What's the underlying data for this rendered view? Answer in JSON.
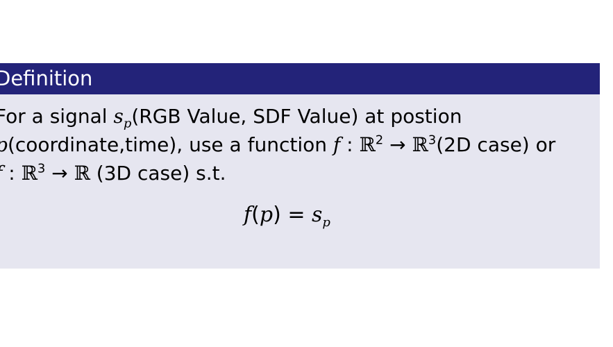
{
  "block": {
    "title": "Definition",
    "colors": {
      "title_bg": "#232379",
      "body_bg": "#e6e6f0",
      "title_text": "#ffffff"
    }
  },
  "body": {
    "line1": {
      "a": "For a signal ",
      "s": "s",
      "s_sub": "p",
      "b": "(RGB Value, SDF Value) at postion"
    },
    "line2": {
      "p": "p",
      "a": "(coordinate,time), use a function ",
      "f": "f",
      "colon": " : ",
      "R1": "ℝ",
      "R1_sup": "2",
      "arrow": " → ",
      "R2": "ℝ",
      "R2_sup": "3",
      "b": "(2D case) or"
    },
    "line3": {
      "f": "f",
      "colon": " : ",
      "R1": "ℝ",
      "R1_sup": "3",
      "arrow": " → ",
      "R2": "ℝ",
      "b": " (3D case) s.t."
    },
    "equation": {
      "f": "f",
      "open": "(",
      "p": "p",
      "close": ")",
      "eq": " = ",
      "s": "s",
      "s_sub": "p"
    }
  }
}
